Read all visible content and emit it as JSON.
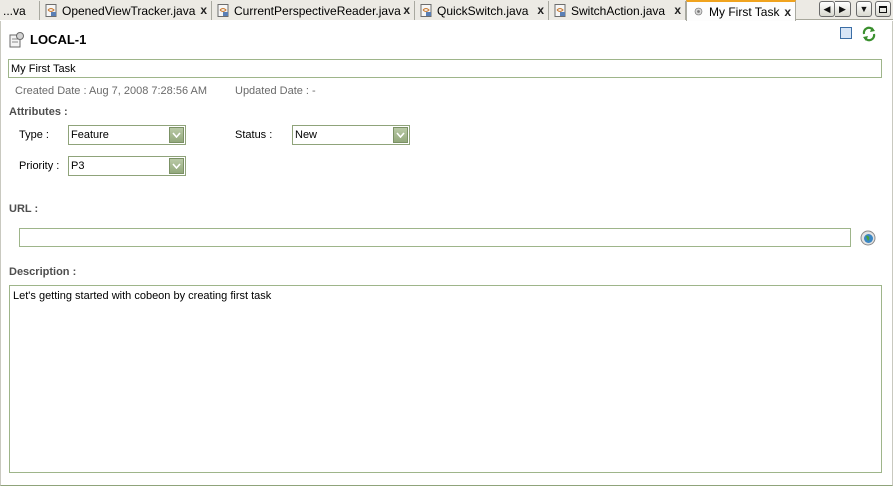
{
  "tabs": [
    {
      "label": "...va",
      "active": false
    },
    {
      "label": "OpenedViewTracker.java",
      "active": false
    },
    {
      "label": "CurrentPerspectiveReader.java",
      "active": false
    },
    {
      "label": "QuickSwitch.java",
      "active": false
    },
    {
      "label": "SwitchAction.java",
      "active": false
    },
    {
      "label": "My First Task",
      "active": true
    }
  ],
  "tab_close_glyph": "x",
  "task": {
    "id": "LOCAL-1",
    "summary": "My First Task",
    "created_date": "Created Date : Aug 7, 2008 7:28:56 AM",
    "updated_date": "Updated Date : -"
  },
  "attributes": {
    "heading": "Attributes :",
    "type_label": "Type :",
    "type_value": "Feature",
    "status_label": "Status :",
    "status_value": "New",
    "priority_label": "Priority :",
    "priority_value": "P3"
  },
  "url": {
    "label": "URL :",
    "value": ""
  },
  "description": {
    "label": "Description :",
    "value": "Let's getting started with cobeon by creating first task"
  },
  "icons": {
    "file": "java-file-icon",
    "task": "task-icon",
    "save": "save-icon",
    "sync": "sync-icon",
    "globe": "globe-icon"
  },
  "colors": {
    "active_tab_accent": "#f0a31e",
    "field_border": "#9eb58a",
    "combo_arrow": "#93a97c"
  }
}
